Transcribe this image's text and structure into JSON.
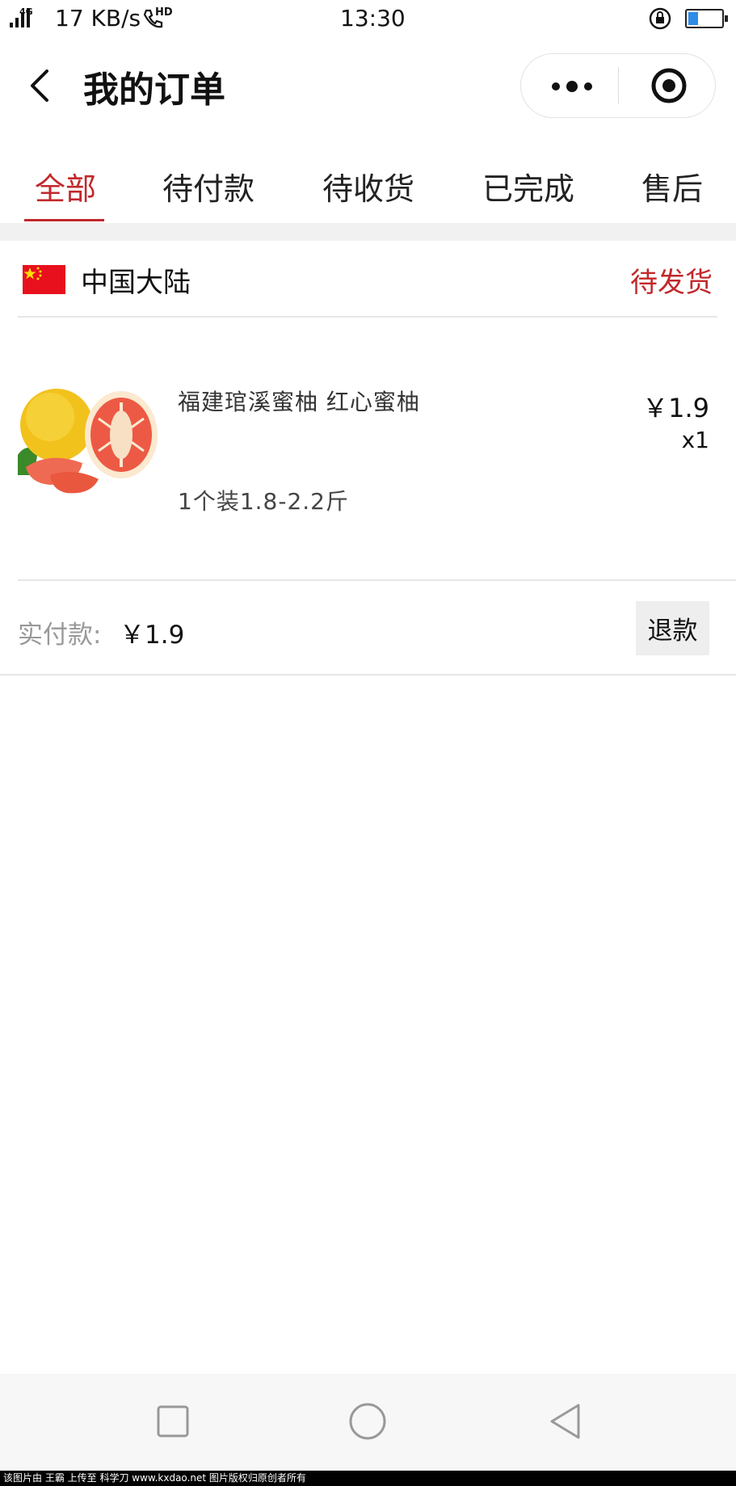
{
  "status_bar": {
    "network": "4G",
    "speed": "17 KB/s",
    "call_badge": "HD",
    "time": "13:30",
    "battery_level": 0.3
  },
  "nav": {
    "title": "我的订单",
    "back_icon": "chevron-left-icon",
    "more_icon": "more-dots-icon",
    "close_icon": "target-icon"
  },
  "tabs": [
    {
      "label": "全部",
      "active": true
    },
    {
      "label": "待付款",
      "active": false
    },
    {
      "label": "待收货",
      "active": false
    },
    {
      "label": "已完成",
      "active": false
    },
    {
      "label": "售后",
      "active": false
    }
  ],
  "order": {
    "region": "中国大陆",
    "region_icon": "china-flag-icon",
    "status": "待发货",
    "product": {
      "name": "福建琯溪蜜柚 红心蜜柚",
      "spec": "1个装1.8-2.2斤",
      "price": "￥1.9",
      "quantity": "x1",
      "image_icon": "pomelo-image"
    },
    "paid_label": "实付款:",
    "paid_value": "￥1.9",
    "refund_label": "退款"
  },
  "colors": {
    "accent": "#c2282b",
    "divider": "#e6e6e6",
    "gap_bg": "#f1f1f1",
    "button_bg": "#eeeeee"
  },
  "system_nav": {
    "icons": [
      "square-icon",
      "circle-icon",
      "triangle-back-icon"
    ]
  },
  "watermark": "该图片由 王霸 上传至 科学刀 www.kxdao.net 图片版权归原创者所有"
}
